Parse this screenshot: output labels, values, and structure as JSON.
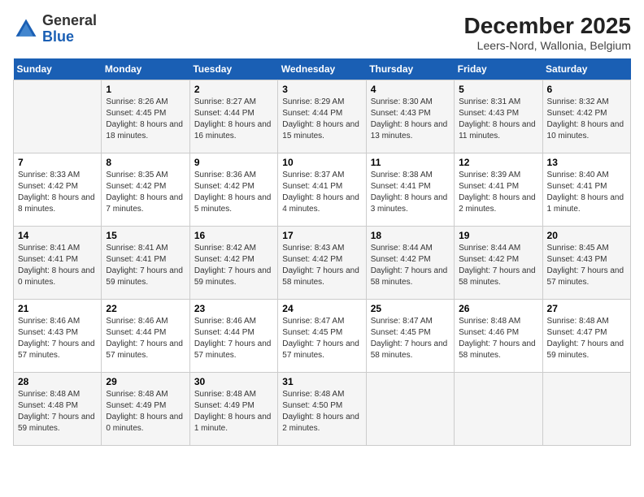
{
  "header": {
    "logo_general": "General",
    "logo_blue": "Blue",
    "month_title": "December 2025",
    "location": "Leers-Nord, Wallonia, Belgium"
  },
  "weekdays": [
    "Sunday",
    "Monday",
    "Tuesday",
    "Wednesday",
    "Thursday",
    "Friday",
    "Saturday"
  ],
  "weeks": [
    [
      {
        "day": "",
        "info": ""
      },
      {
        "day": "1",
        "info": "Sunrise: 8:26 AM\nSunset: 4:45 PM\nDaylight: 8 hours\nand 18 minutes."
      },
      {
        "day": "2",
        "info": "Sunrise: 8:27 AM\nSunset: 4:44 PM\nDaylight: 8 hours\nand 16 minutes."
      },
      {
        "day": "3",
        "info": "Sunrise: 8:29 AM\nSunset: 4:44 PM\nDaylight: 8 hours\nand 15 minutes."
      },
      {
        "day": "4",
        "info": "Sunrise: 8:30 AM\nSunset: 4:43 PM\nDaylight: 8 hours\nand 13 minutes."
      },
      {
        "day": "5",
        "info": "Sunrise: 8:31 AM\nSunset: 4:43 PM\nDaylight: 8 hours\nand 11 minutes."
      },
      {
        "day": "6",
        "info": "Sunrise: 8:32 AM\nSunset: 4:42 PM\nDaylight: 8 hours\nand 10 minutes."
      }
    ],
    [
      {
        "day": "7",
        "info": "Sunrise: 8:33 AM\nSunset: 4:42 PM\nDaylight: 8 hours\nand 8 minutes."
      },
      {
        "day": "8",
        "info": "Sunrise: 8:35 AM\nSunset: 4:42 PM\nDaylight: 8 hours\nand 7 minutes."
      },
      {
        "day": "9",
        "info": "Sunrise: 8:36 AM\nSunset: 4:42 PM\nDaylight: 8 hours\nand 5 minutes."
      },
      {
        "day": "10",
        "info": "Sunrise: 8:37 AM\nSunset: 4:41 PM\nDaylight: 8 hours\nand 4 minutes."
      },
      {
        "day": "11",
        "info": "Sunrise: 8:38 AM\nSunset: 4:41 PM\nDaylight: 8 hours\nand 3 minutes."
      },
      {
        "day": "12",
        "info": "Sunrise: 8:39 AM\nSunset: 4:41 PM\nDaylight: 8 hours\nand 2 minutes."
      },
      {
        "day": "13",
        "info": "Sunrise: 8:40 AM\nSunset: 4:41 PM\nDaylight: 8 hours\nand 1 minute."
      }
    ],
    [
      {
        "day": "14",
        "info": "Sunrise: 8:41 AM\nSunset: 4:41 PM\nDaylight: 8 hours\nand 0 minutes."
      },
      {
        "day": "15",
        "info": "Sunrise: 8:41 AM\nSunset: 4:41 PM\nDaylight: 7 hours\nand 59 minutes."
      },
      {
        "day": "16",
        "info": "Sunrise: 8:42 AM\nSunset: 4:42 PM\nDaylight: 7 hours\nand 59 minutes."
      },
      {
        "day": "17",
        "info": "Sunrise: 8:43 AM\nSunset: 4:42 PM\nDaylight: 7 hours\nand 58 minutes."
      },
      {
        "day": "18",
        "info": "Sunrise: 8:44 AM\nSunset: 4:42 PM\nDaylight: 7 hours\nand 58 minutes."
      },
      {
        "day": "19",
        "info": "Sunrise: 8:44 AM\nSunset: 4:42 PM\nDaylight: 7 hours\nand 58 minutes."
      },
      {
        "day": "20",
        "info": "Sunrise: 8:45 AM\nSunset: 4:43 PM\nDaylight: 7 hours\nand 57 minutes."
      }
    ],
    [
      {
        "day": "21",
        "info": "Sunrise: 8:46 AM\nSunset: 4:43 PM\nDaylight: 7 hours\nand 57 minutes."
      },
      {
        "day": "22",
        "info": "Sunrise: 8:46 AM\nSunset: 4:44 PM\nDaylight: 7 hours\nand 57 minutes."
      },
      {
        "day": "23",
        "info": "Sunrise: 8:46 AM\nSunset: 4:44 PM\nDaylight: 7 hours\nand 57 minutes."
      },
      {
        "day": "24",
        "info": "Sunrise: 8:47 AM\nSunset: 4:45 PM\nDaylight: 7 hours\nand 57 minutes."
      },
      {
        "day": "25",
        "info": "Sunrise: 8:47 AM\nSunset: 4:45 PM\nDaylight: 7 hours\nand 58 minutes."
      },
      {
        "day": "26",
        "info": "Sunrise: 8:48 AM\nSunset: 4:46 PM\nDaylight: 7 hours\nand 58 minutes."
      },
      {
        "day": "27",
        "info": "Sunrise: 8:48 AM\nSunset: 4:47 PM\nDaylight: 7 hours\nand 59 minutes."
      }
    ],
    [
      {
        "day": "28",
        "info": "Sunrise: 8:48 AM\nSunset: 4:48 PM\nDaylight: 7 hours\nand 59 minutes."
      },
      {
        "day": "29",
        "info": "Sunrise: 8:48 AM\nSunset: 4:49 PM\nDaylight: 8 hours\nand 0 minutes."
      },
      {
        "day": "30",
        "info": "Sunrise: 8:48 AM\nSunset: 4:49 PM\nDaylight: 8 hours\nand 1 minute."
      },
      {
        "day": "31",
        "info": "Sunrise: 8:48 AM\nSunset: 4:50 PM\nDaylight: 8 hours\nand 2 minutes."
      },
      {
        "day": "",
        "info": ""
      },
      {
        "day": "",
        "info": ""
      },
      {
        "day": "",
        "info": ""
      }
    ]
  ]
}
